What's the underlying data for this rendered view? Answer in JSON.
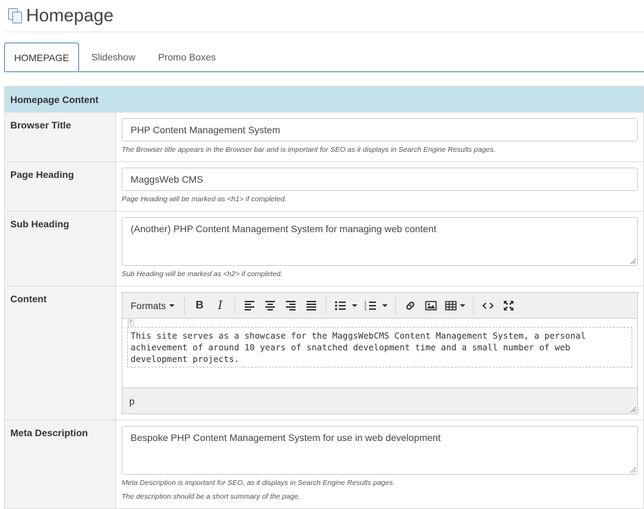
{
  "page": {
    "title": "Homepage"
  },
  "tabs": [
    {
      "label": "HOMEPAGE",
      "active": true
    },
    {
      "label": "Slideshow",
      "active": false
    },
    {
      "label": "Promo Boxes",
      "active": false
    }
  ],
  "section": {
    "title": "Homepage Content"
  },
  "fields": {
    "browser_title": {
      "label": "Browser Title",
      "value": "PHP Content Management System",
      "help": "The Browser title appears in the Browser bar and is important for SEO as it displays in Search Engine Results pages."
    },
    "page_heading": {
      "label": "Page Heading",
      "value": "MaggsWeb CMS",
      "help": "Page Heading will be marked as <h1> if completed."
    },
    "sub_heading": {
      "label": "Sub Heading",
      "value": "(Another) PHP Content Management System for managing web content",
      "help": "Sub Heading will be marked as <h2> if completed."
    },
    "content": {
      "label": "Content",
      "formats_label": "Formats",
      "body": "This site serves as a showcase for the MaggsWebCMS Content Management System, a personal achievement of around 10 years of snatched development time and a small number of web development projects.",
      "block_marker": "P",
      "status_path": "p"
    },
    "meta_description": {
      "label": "Meta Description",
      "value": "Bespoke PHP Content Management System for use in web development",
      "help1": "Meta Description is important for SEO, as it displays in Search Engine Results pages.",
      "help2": "The description should be a short summary of the page."
    }
  },
  "toolbar_icons": [
    "bold-icon",
    "italic-icon",
    "align-left-icon",
    "align-center-icon",
    "align-right-icon",
    "align-justify-icon",
    "bullet-list-icon",
    "numbered-list-icon",
    "link-icon",
    "image-icon",
    "table-icon",
    "source-code-icon",
    "fullscreen-icon"
  ]
}
